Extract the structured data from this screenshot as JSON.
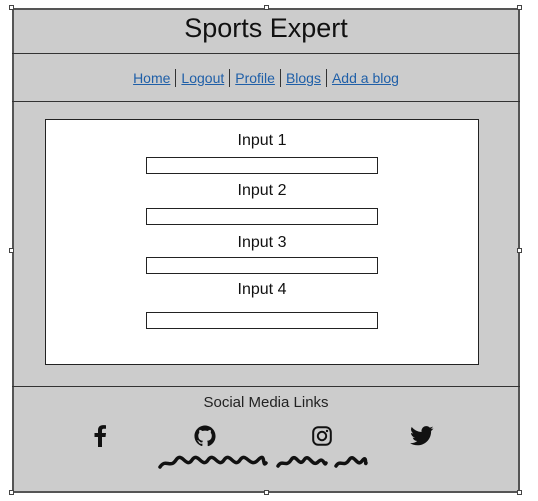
{
  "header": {
    "title": "Sports Expert"
  },
  "nav": {
    "items": [
      {
        "label": "Home"
      },
      {
        "label": "Logout"
      },
      {
        "label": "Profile"
      },
      {
        "label": "Blogs"
      },
      {
        "label": "Add a blog"
      }
    ]
  },
  "form": {
    "fields": [
      {
        "label": "Input 1",
        "value": ""
      },
      {
        "label": "Input 2",
        "value": ""
      },
      {
        "label": "Input 3",
        "value": ""
      },
      {
        "label": "Input 4",
        "value": ""
      }
    ]
  },
  "footer": {
    "title": "Social Media Links",
    "icons": [
      "facebook-icon",
      "github-icon",
      "instagram-icon",
      "twitter-icon"
    ]
  },
  "colors": {
    "background": "#cccccc",
    "link": "#1f5fa8",
    "panel": "#ffffff"
  }
}
